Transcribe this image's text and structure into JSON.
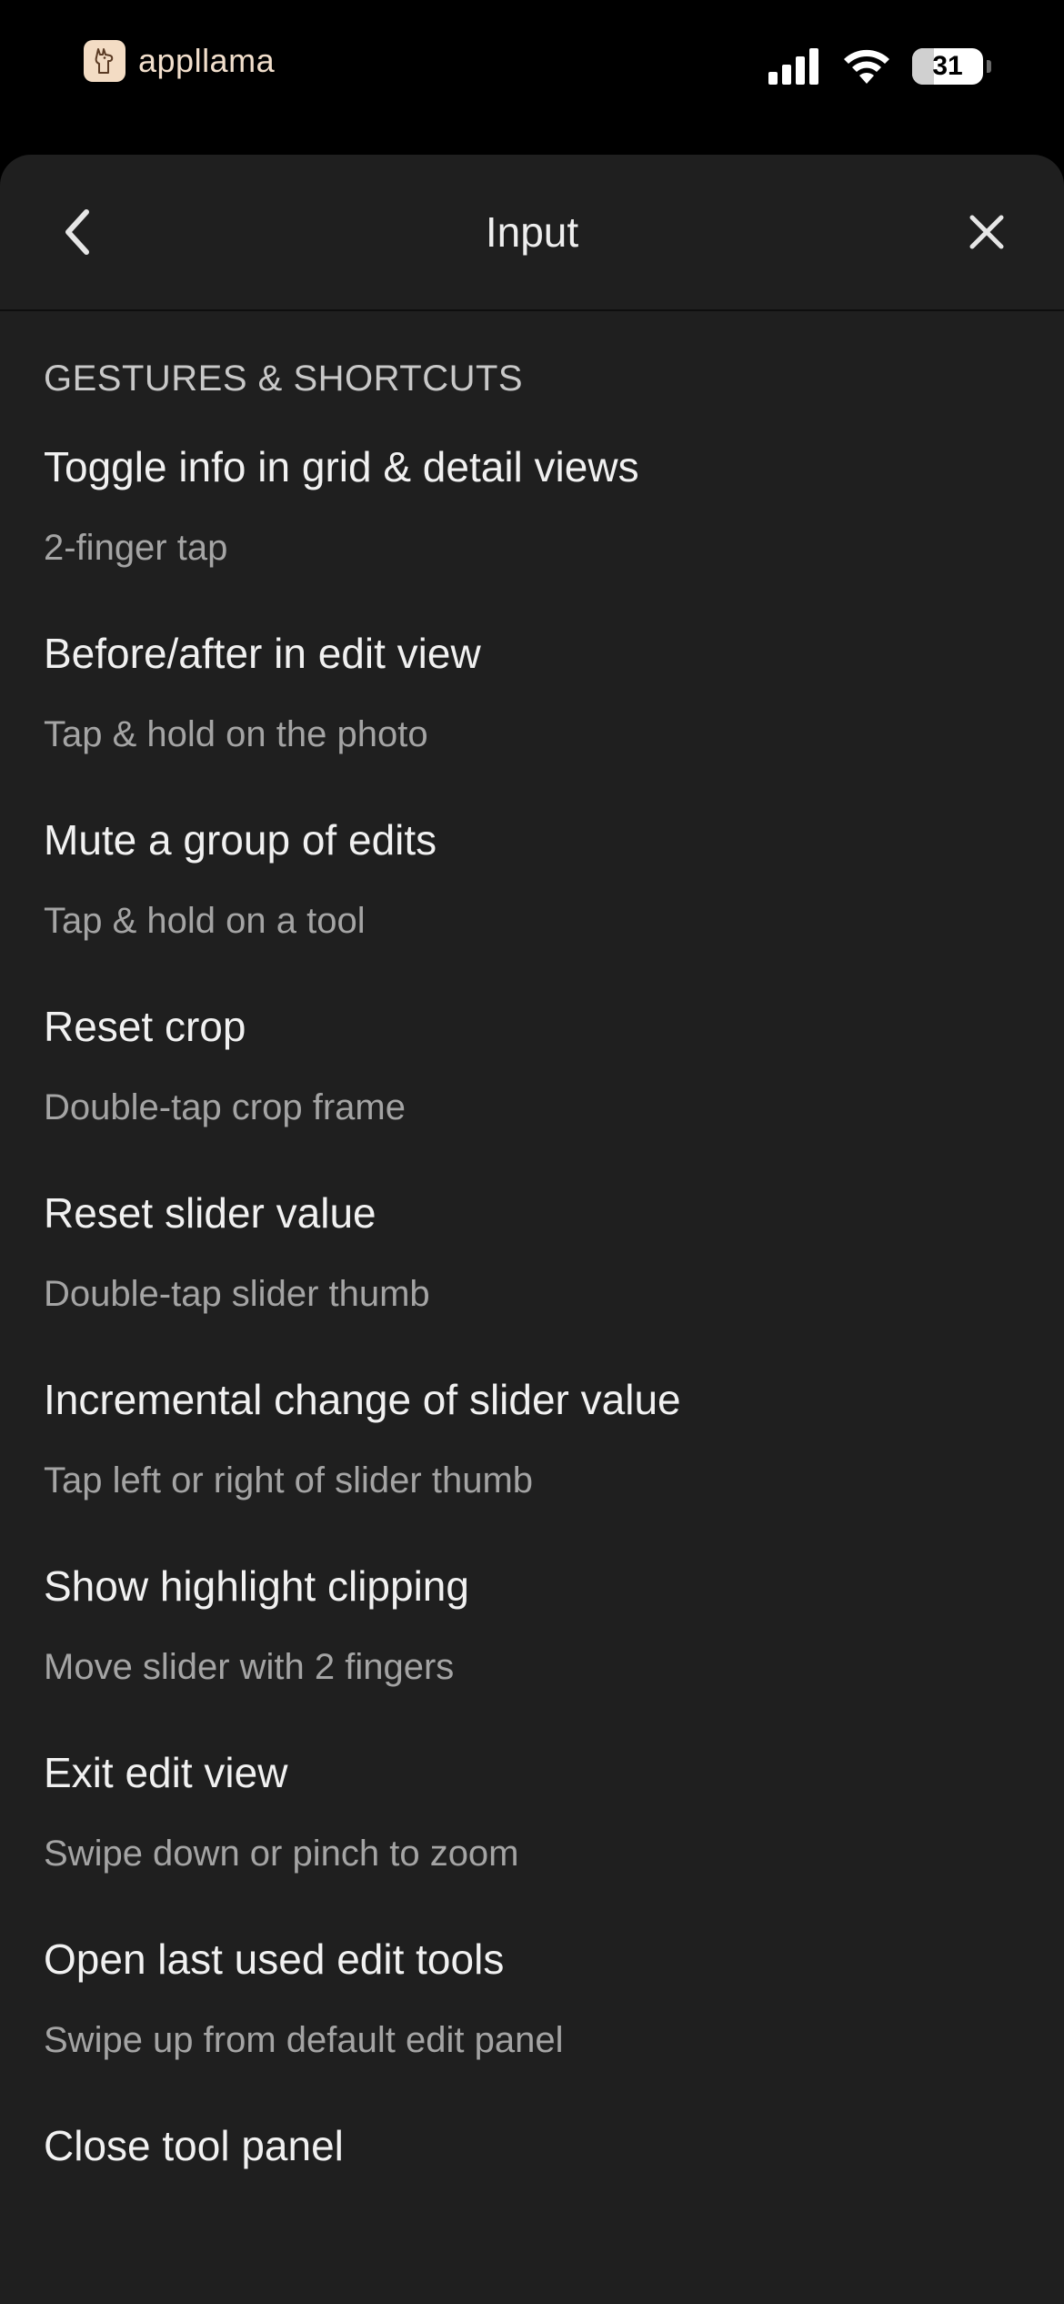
{
  "status_bar": {
    "brand_name": "appllama",
    "battery_level": "31",
    "battery_fraction": 0.31
  },
  "header": {
    "title": "Input",
    "back_icon": "chevron-left-icon",
    "close_icon": "close-icon"
  },
  "section": {
    "title": "GESTURES & SHORTCUTS"
  },
  "shortcuts": [
    {
      "title": "Toggle info in grid & detail views",
      "desc": "2-finger tap"
    },
    {
      "title": "Before/after in edit view",
      "desc": "Tap & hold on the photo"
    },
    {
      "title": "Mute a group of edits",
      "desc": "Tap & hold on a tool"
    },
    {
      "title": "Reset crop",
      "desc": "Double-tap crop frame"
    },
    {
      "title": "Reset slider value",
      "desc": "Double-tap slider thumb"
    },
    {
      "title": "Incremental change of slider value",
      "desc": "Tap left or right of slider thumb"
    },
    {
      "title": "Show highlight clipping",
      "desc": "Move slider with 2 fingers"
    },
    {
      "title": "Exit edit view",
      "desc": "Swipe down or pinch to zoom"
    },
    {
      "title": "Open last used edit tools",
      "desc": "Swipe up from default edit panel"
    },
    {
      "title": "Close tool panel",
      "desc": ""
    }
  ],
  "colors": {
    "background": "#000000",
    "sheet": "#1f1f1f",
    "title_text": "#f1f1f1",
    "secondary_text": "#a4a4a4",
    "brand": "#f3dcc4"
  }
}
